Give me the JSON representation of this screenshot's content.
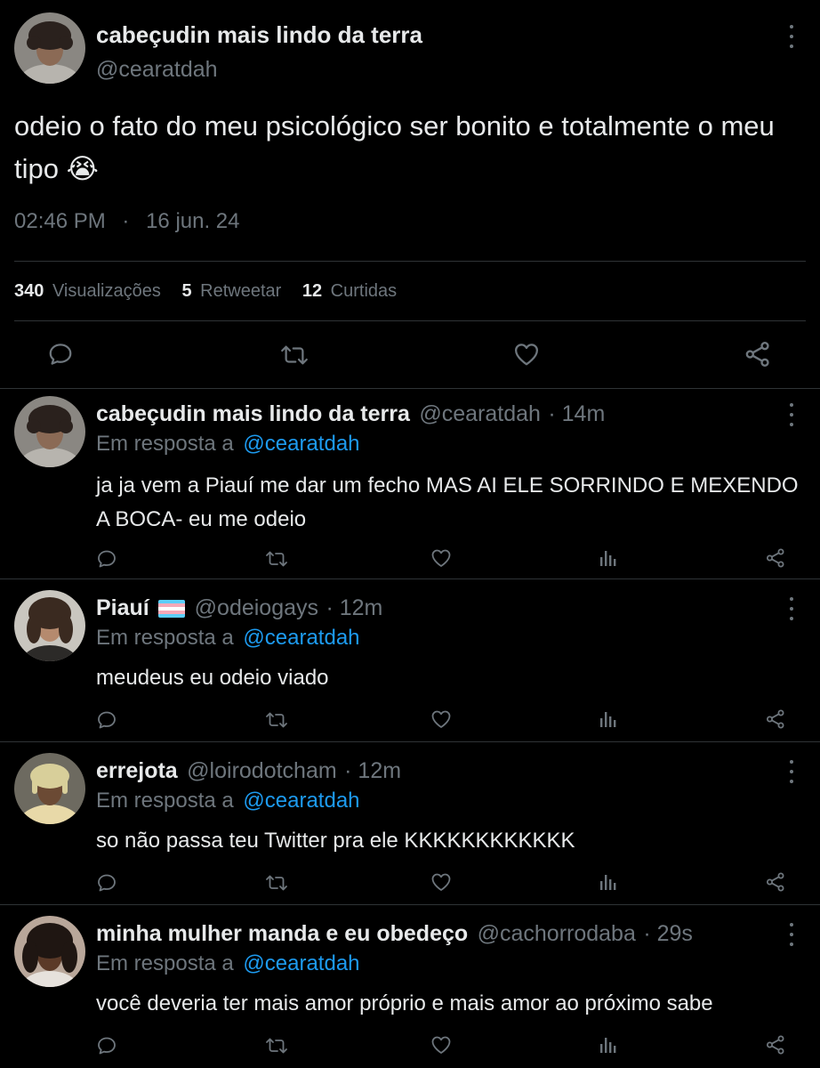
{
  "tweet": {
    "display_name": "cabeçudin mais lindo da terra",
    "handle": "@cearatdah",
    "text": "odeio o fato do meu psicológico ser bonito e totalmente o meu tipo 😭",
    "time": "02:46 PM",
    "separator": "·",
    "date": "16 jun. 24",
    "stats": {
      "views_count": "340",
      "views_label": "Visualizações",
      "retweets_count": "5",
      "retweets_label": "Retweetar",
      "likes_count": "12",
      "likes_label": "Curtidas"
    },
    "actions": [
      "comment-icon",
      "retweet-icon",
      "heart-icon",
      "share-icon"
    ]
  },
  "replies": [
    {
      "name": "cabeçudin mais lindo da terra",
      "handle": "@cearatdah",
      "time": "· 14m",
      "reply_to_prefix": "Em resposta a",
      "reply_to_handle": "@cearatdah",
      "text": "ja ja vem a Piauí me dar um fecho MAS AI ELE SORRINDO E MEXENDO A BOCA- eu me odeio"
    },
    {
      "name": "Piauí",
      "flag": "transgender-flag",
      "handle": "@odeiogays",
      "time": "· 12m",
      "reply_to_prefix": "Em resposta a",
      "reply_to_handle": "@cearatdah",
      "text": "meudeus eu odeio viado"
    },
    {
      "name": "errejota",
      "handle": "@loirodotcham",
      "time": "· 12m",
      "reply_to_prefix": "Em resposta a",
      "reply_to_handle": "@cearatdah",
      "text": "so não passa teu Twitter pra ele KKKKKKKKKKKK"
    },
    {
      "name": "minha mulher manda e eu obedeço",
      "handle": "@cachorrodaba",
      "time": "· 29s",
      "reply_to_prefix": "Em resposta a",
      "reply_to_handle": "@cearatdah",
      "text": "você deveria ter mais amor próprio e mais amor ao próximo sabe"
    }
  ],
  "colors": {
    "background": "#000000",
    "text": "#e7e9ea",
    "muted": "#6e767d",
    "accent": "#1d9bf0",
    "divider": "#2f3336"
  }
}
